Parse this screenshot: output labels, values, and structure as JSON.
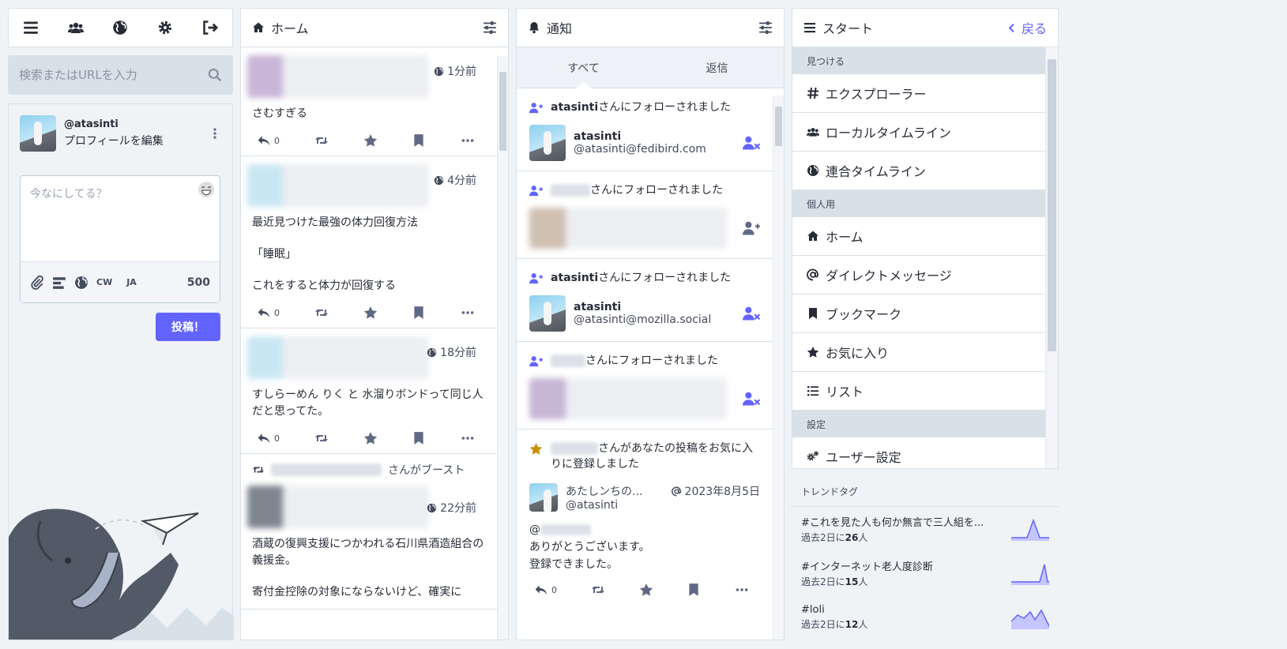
{
  "search": {
    "placeholder": "検索またはURLを入力"
  },
  "profile": {
    "handle": "@atasinti",
    "edit_label": "プロフィールを編集"
  },
  "compose": {
    "placeholder": "今なにしてる？",
    "cw_label": "CW",
    "lang_label": "JA",
    "char_count": "500",
    "post_label": "投稿！"
  },
  "home": {
    "title": "ホーム",
    "statuses": [
      {
        "time": "1分前",
        "paragraphs": [
          "さむすぎる"
        ],
        "replies": "0"
      },
      {
        "time": "4分前",
        "paragraphs": [
          "最近見つけた最強の体力回復方法",
          "「睡眠」",
          "これをすると体力が回復する"
        ],
        "replies": "0"
      },
      {
        "time": "18分前",
        "paragraphs": [
          "すしらーめん りく と 水溜りボンドって同じ人だと思ってた。"
        ],
        "replies": "0"
      },
      {
        "boost_label": "さんがブースト",
        "time": "22分前",
        "paragraphs": [
          "酒蔵の復興支援につかわれる石川県酒造組合の義援金。",
          "寄付金控除の対象にならないけど、確実に"
        ]
      }
    ]
  },
  "notifications": {
    "title": "通知",
    "tabs": [
      "すべて",
      "返信"
    ],
    "items": [
      {
        "user": "atasinti",
        "text": "さんにフォローされました",
        "display_name": "atasinti",
        "acct": "@atasinti@fedibird.com"
      },
      {
        "text": "さんにフォローされました"
      },
      {
        "user": "atasinti",
        "text": "さんにフォローされました",
        "display_name": "atasinti",
        "acct": "@atasinti@mozilla.social"
      },
      {
        "text": "さんにフォローされました"
      },
      {
        "text": "さんがあなたの投稿をお気に入りに登録しました",
        "status_author": "あたしンちの...",
        "status_acct": "@atasinti",
        "status_date": "2023年8月5日",
        "body_lines": [
          "@",
          "ありがとうございます。",
          "登録できました。"
        ],
        "replies": "0"
      }
    ]
  },
  "start": {
    "title": "スタート",
    "back_label": "戻る",
    "sections": [
      {
        "label": "見つける",
        "items": [
          "エクスプローラー",
          "ローカルタイムライン",
          "連合タイムライン"
        ]
      },
      {
        "label": "個人用",
        "items": [
          "ホーム",
          "ダイレクトメッセージ",
          "ブックマーク",
          "お気に入り",
          "リスト"
        ]
      },
      {
        "label": "設定",
        "items": [
          "ユーザー設定"
        ]
      }
    ]
  },
  "trends": {
    "title": "トレンドタグ",
    "uses_prefix": "過去2日に",
    "uses_suffix": "人",
    "items": [
      {
        "tag": "#これを見た人も何か無言で三人組を...",
        "count": "26"
      },
      {
        "tag": "#インターネット老人度診断",
        "count": "15"
      },
      {
        "tag": "#loli",
        "count": "12"
      }
    ]
  },
  "colors": {
    "accent": "#6364ff",
    "favourite": "#ca8f04",
    "background": "#eff3f5"
  }
}
